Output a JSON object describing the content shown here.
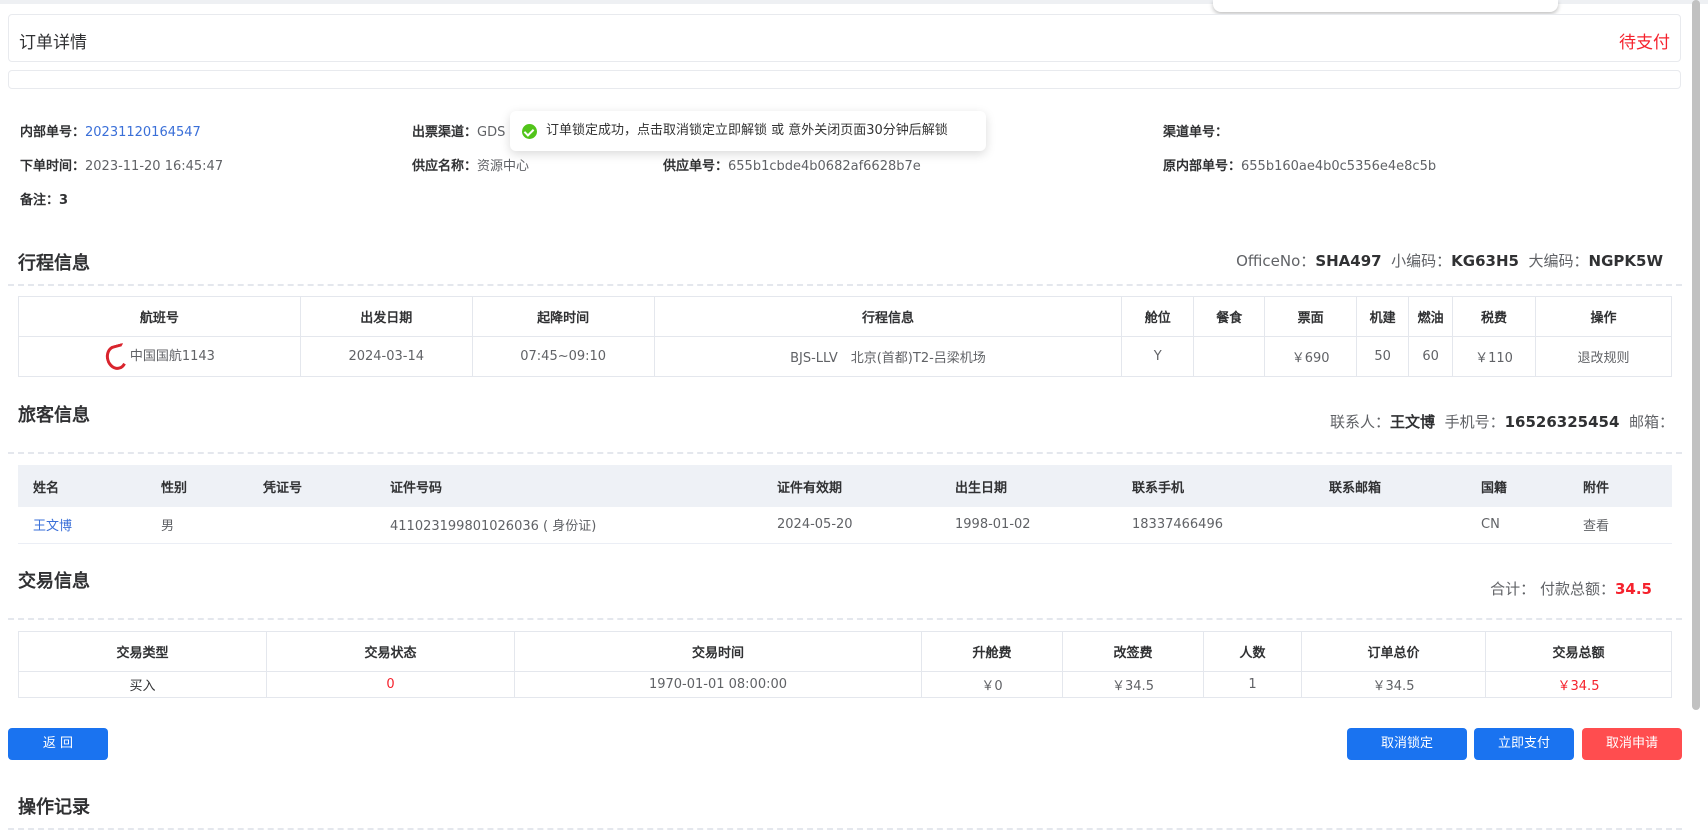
{
  "header": {
    "title": "订单详情",
    "status": "待支付"
  },
  "order": {
    "internal_no_label": "内部单号：",
    "internal_no": "20231120164547",
    "channel_label": "出票渠道：",
    "channel": "GDS",
    "channel_no_label": "渠道单号：",
    "channel_no": "",
    "order_time_label": "下单时间：",
    "order_time": "2023-11-20 16:45:47",
    "supplier_name_label": "供应名称：",
    "supplier_name": "资源中心",
    "supplier_no_label": "供应单号：",
    "supplier_no": "655b1cbde4b0682af6628b7e",
    "orig_internal_no_label": "原内部单号：",
    "orig_internal_no": "655b160ae4b0c5356e4e8c5b",
    "remark_label": "备注：",
    "remark": "3"
  },
  "toast": {
    "message": "订单锁定成功，点击取消锁定立即解锁 或 意外关闭页面30分钟后解锁"
  },
  "itinerary": {
    "title": "行程信息",
    "office_label": "OfficeNo：",
    "office": "SHA497",
    "small_code_label": "小编码：",
    "small_code": "KG63H5",
    "big_code_label": "大编码：",
    "big_code": "NGPK5W",
    "columns": [
      "航班号",
      "出发日期",
      "起降时间",
      "行程信息",
      "舱位",
      "餐食",
      "票面",
      "机建",
      "燃油",
      "税费",
      "操作"
    ],
    "row": {
      "flight": "中国国航1143",
      "date": "2024-03-14",
      "time": "07:45~09:10",
      "route": "BJS-LLV　北京(首都)T2-吕梁机场",
      "cabin": "Y",
      "meal": "",
      "fare": "￥690",
      "airport_fee": "50",
      "fuel": "60",
      "tax": "￥110",
      "action": "退改规则"
    }
  },
  "passengers": {
    "title": "旅客信息",
    "contact_label": "联系人：",
    "contact": "王文博",
    "phone_label": "手机号：",
    "phone": "16526325454",
    "email_label": "邮箱：",
    "email": "",
    "columns": [
      "姓名",
      "性别",
      "凭证号",
      "证件号码",
      "证件有效期",
      "出生日期",
      "联系手机",
      "联系邮箱",
      "国籍",
      "附件"
    ],
    "row": {
      "name": "王文博",
      "gender": "男",
      "voucher": "",
      "id_no": "411023199801026036 ( 身份证)",
      "id_expiry": "2024-05-20",
      "birth": "1998-01-02",
      "mobile": "18337466496",
      "email": "",
      "nationality": "CN",
      "attachment": "查看"
    }
  },
  "transaction": {
    "title": "交易信息",
    "total_label": "合计：",
    "pay_total_label": "付款总额：",
    "pay_total": "34.5",
    "columns": [
      "交易类型",
      "交易状态",
      "交易时间",
      "升舱费",
      "改签费",
      "人数",
      "订单总价",
      "交易总额"
    ],
    "row": {
      "type": "买入",
      "status": "0",
      "time": "1970-01-01 08:00:00",
      "upgrade_fee": "￥0",
      "change_fee": "￥34.5",
      "count": "1",
      "order_total": "￥34.5",
      "trade_total": "￥34.5"
    }
  },
  "buttons": {
    "back": "返 回",
    "cancel_lock": "取消锁定",
    "pay_now": "立即支付",
    "cancel_apply": "取消申请"
  },
  "log": {
    "title": "操作记录"
  }
}
